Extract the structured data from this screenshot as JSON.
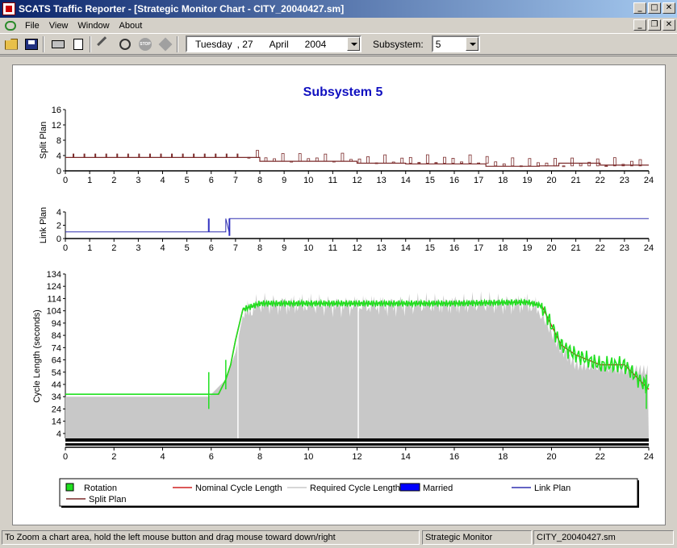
{
  "window": {
    "title": "SCATS Traffic Reporter - [Strategic Monitor Chart - CITY_20040427.sm]",
    "minimize": "_",
    "maximize": "□",
    "close": "✕",
    "mdi_minimize": "_",
    "mdi_restore": "❐",
    "mdi_close": "✕"
  },
  "menu": {
    "items": [
      "File",
      "View",
      "Window",
      "About"
    ]
  },
  "toolbar": {
    "date_day": "Tuesday",
    "date_num": ", 27",
    "date_month": "April",
    "date_year": "2004",
    "subsystem_label": "Subsystem:",
    "subsystem_value": "5",
    "icons": [
      "open-folder-icon",
      "save-icon",
      "print-icon",
      "print-preview-icon",
      "tools-icon",
      "timer-icon",
      "stop-icon",
      "diamond-icon"
    ],
    "stop_text": "STOP"
  },
  "chart_data": [
    {
      "type": "line",
      "title": "Subsystem 5",
      "ylabel": "Split Plan",
      "ylim": [
        0,
        16
      ],
      "yticks": [
        0,
        4,
        8,
        12,
        16
      ],
      "xlim": [
        0,
        24
      ],
      "xticks": [
        0,
        1,
        2,
        3,
        4,
        5,
        6,
        7,
        8,
        9,
        10,
        11,
        12,
        13,
        14,
        15,
        16,
        17,
        18,
        19,
        20,
        21,
        22,
        23,
        24
      ],
      "color": "#7b2a2a",
      "series": [
        {
          "name": "Split Plan",
          "x": [
            0,
            7.4,
            8.0,
            10.0,
            12.0,
            14.0,
            17.3,
            19.5,
            20.3,
            22.0,
            24
          ],
          "values": [
            3.5,
            3.5,
            2.5,
            2.5,
            2.0,
            1.8,
            1.2,
            1.3,
            2.0,
            1.5,
            1.5
          ]
        }
      ]
    },
    {
      "type": "line",
      "ylabel": "Link Plan",
      "ylim": [
        0,
        4
      ],
      "yticks": [
        0,
        2,
        4
      ],
      "xlim": [
        0,
        24
      ],
      "xticks": [
        0,
        1,
        2,
        3,
        4,
        5,
        6,
        7,
        8,
        9,
        10,
        11,
        12,
        13,
        14,
        15,
        16,
        17,
        18,
        19,
        20,
        21,
        22,
        23,
        24
      ],
      "color": "#3030b0",
      "series": [
        {
          "name": "Link Plan",
          "x": [
            0,
            5.9,
            5.9,
            5.9,
            6.6,
            6.6,
            6.75,
            6.75,
            24
          ],
          "values": [
            1,
            1,
            3,
            1,
            1,
            3,
            0.8,
            3,
            3
          ]
        }
      ]
    },
    {
      "type": "line",
      "ylabel": "Cycle Length (seconds)",
      "ylim": [
        0,
        134
      ],
      "yticks": [
        4,
        14,
        24,
        34,
        44,
        54,
        64,
        74,
        84,
        94,
        104,
        114,
        124,
        134
      ],
      "xlim": [
        0,
        24
      ],
      "xticks": [
        0,
        2,
        4,
        6,
        8,
        10,
        12,
        14,
        16,
        18,
        20,
        22,
        24
      ],
      "series": [
        {
          "name": "Required Cycle Length",
          "color": "#c8c8c8",
          "x": [
            0,
            5.9,
            6.6,
            7.0,
            7.3,
            8.0,
            12.0,
            16.0,
            19.0,
            19.5,
            20.3,
            21.0,
            24
          ],
          "values": [
            34,
            34,
            48,
            70,
            100,
            110,
            108,
            110,
            110,
            105,
            75,
            60,
            55
          ]
        },
        {
          "name": "Nominal Cycle Length",
          "color": "#d02020",
          "x": [
            0,
            5.9,
            6.3,
            6.6,
            6.8,
            7.0,
            7.3,
            8.0,
            12.0,
            16.0,
            19.0,
            19.6,
            20.0,
            20.4,
            21.0,
            22.0,
            23.0,
            24
          ],
          "values": [
            36,
            36,
            36,
            48,
            60,
            80,
            105,
            110,
            110,
            110,
            111,
            108,
            92,
            76,
            68,
            60,
            60,
            40
          ]
        },
        {
          "name": "Rotation",
          "color": "#20e020",
          "x": [
            0,
            5.9,
            6.3,
            6.6,
            6.8,
            7.0,
            7.3,
            8.0,
            12.0,
            16.0,
            19.0,
            19.6,
            20.0,
            20.4,
            21.0,
            22.0,
            23.0,
            24
          ],
          "values": [
            36,
            36,
            36,
            48,
            60,
            80,
            105,
            110,
            110,
            110,
            111,
            108,
            92,
            76,
            68,
            60,
            60,
            40
          ]
        },
        {
          "name": "Married",
          "color": "#0000ff",
          "values": []
        }
      ]
    }
  ],
  "legend": {
    "items": [
      {
        "label": "Rotation",
        "color": "#20e020",
        "kind": "box"
      },
      {
        "label": "Nominal Cycle Length",
        "color": "#d02020",
        "kind": "line"
      },
      {
        "label": "Required Cycle Length",
        "color": "#c8c8c8",
        "kind": "line"
      },
      {
        "label": "Married",
        "color": "#0000ff",
        "kind": "bar"
      },
      {
        "label": "Link Plan",
        "color": "#3030b0",
        "kind": "line"
      },
      {
        "label": "Split Plan",
        "color": "#7b2a2a",
        "kind": "line"
      }
    ]
  },
  "status": {
    "hint": "To Zoom a chart area, hold the left mouse button and drag mouse toward down/right",
    "mode": "Strategic Monitor",
    "file": "CITY_20040427.sm"
  }
}
